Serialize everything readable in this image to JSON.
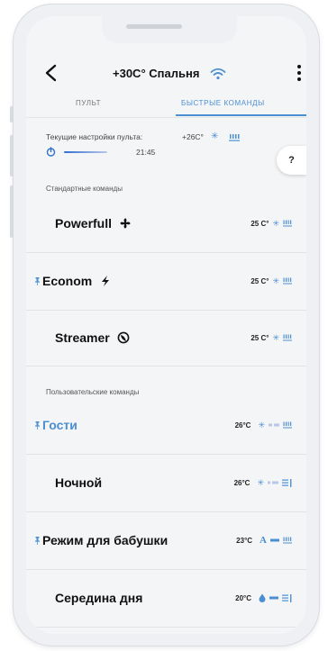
{
  "header": {
    "title": "+30C° Спальня"
  },
  "tabs": [
    {
      "label": "ПУЛЬТ",
      "active": false
    },
    {
      "label": "БЫСТРЫЕ КОМАНДЫ",
      "active": true
    }
  ],
  "current": {
    "label": "Текущие настройки пульта:",
    "temp": "+26C°",
    "timer": "21:45"
  },
  "help_label": "?",
  "sections": {
    "standard": "Стандартные команды",
    "custom": "Пользовательские команды"
  },
  "standard_commands": [
    {
      "name": "Powerfull",
      "temp": "25 C°"
    },
    {
      "name": "Econom",
      "temp": "25 C°"
    },
    {
      "name": "Streamer",
      "temp": "25 C°"
    }
  ],
  "custom_commands": [
    {
      "name": "Гости",
      "temp": "26°C"
    },
    {
      "name": "Ночной",
      "temp": "26°C"
    },
    {
      "name": "Режим для бабушки",
      "temp": "23°C"
    },
    {
      "name": "Середина дня",
      "temp": "20°C"
    }
  ],
  "colors": {
    "accent": "#4b8fd1",
    "text": "#111111",
    "background": "#f4f5f7"
  },
  "icons": {
    "snowflake": "snowflake-icon",
    "fan": "fan-speed-icon",
    "wifi": "wifi-icon",
    "pin": "pin-icon"
  }
}
